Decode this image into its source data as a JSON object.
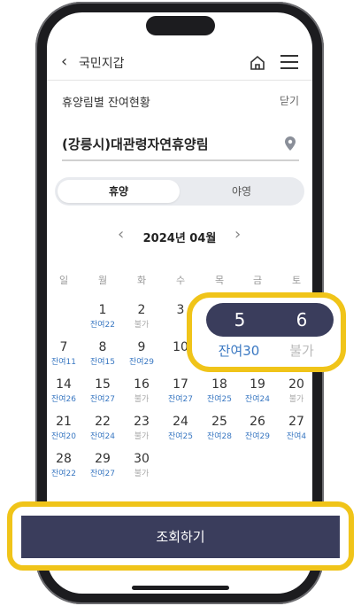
{
  "header": {
    "back_label": "국민지갑"
  },
  "panel": {
    "title": "휴양림별 잔여현황",
    "close_label": "닫기"
  },
  "forest": {
    "name": "(강릉시)대관령자연휴양림"
  },
  "tabs": [
    {
      "label": "휴양",
      "active": true
    },
    {
      "label": "야영",
      "active": false
    }
  ],
  "calendar": {
    "month_label": "2024년 04월",
    "weekdays": [
      "일",
      "월",
      "화",
      "수",
      "목",
      "금",
      "토"
    ],
    "days": [
      {
        "n": "1",
        "status": "잔여22"
      },
      {
        "n": "2",
        "status": "불가"
      },
      {
        "n": "3",
        "status": ""
      },
      {
        "n": "7",
        "status": "잔여11"
      },
      {
        "n": "8",
        "status": "잔여15"
      },
      {
        "n": "9",
        "status": "잔여29"
      },
      {
        "n": "10",
        "status": ""
      },
      {
        "n": "14",
        "status": "잔여26"
      },
      {
        "n": "15",
        "status": "잔여27"
      },
      {
        "n": "16",
        "status": "불가"
      },
      {
        "n": "17",
        "status": "잔여27"
      },
      {
        "n": "18",
        "status": "잔여25"
      },
      {
        "n": "19",
        "status": "잔여24"
      },
      {
        "n": "20",
        "status": "불가"
      },
      {
        "n": "21",
        "status": "잔여20"
      },
      {
        "n": "22",
        "status": "잔여24"
      },
      {
        "n": "23",
        "status": "불가"
      },
      {
        "n": "24",
        "status": "잔여25"
      },
      {
        "n": "25",
        "status": "잔여28"
      },
      {
        "n": "26",
        "status": "잔여29"
      },
      {
        "n": "27",
        "status": "잔여4"
      },
      {
        "n": "28",
        "status": "잔여22"
      },
      {
        "n": "29",
        "status": "잔여27"
      },
      {
        "n": "30",
        "status": "불가"
      }
    ],
    "highlight": {
      "day5": "5",
      "day6": "6",
      "day5_status": "잔여30",
      "day6_status": "불가"
    }
  },
  "cta": {
    "label": "조회하기"
  },
  "colors": {
    "accent_navy": "#3a3d5c",
    "highlight_yellow": "#f0c419",
    "available_blue": "#3a78c2",
    "unavailable_gray": "#aaaaaa"
  }
}
